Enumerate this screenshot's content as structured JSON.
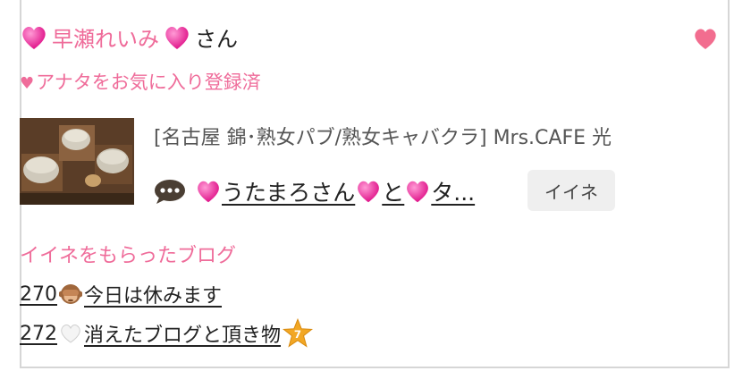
{
  "header": {
    "user_name": "早瀬れいみ",
    "suffix": "さん",
    "fav_icon": "heart-icon",
    "colors": {
      "accent": "#ef6c9a",
      "heart": "#f26d8f"
    }
  },
  "favorite_status": {
    "heart": "♥",
    "label": "アナタをお気に入り登録済"
  },
  "activity": {
    "shop_label": "[名古屋 錦･熟女パブ/熟女キャバクラ]  Mrs.CAFE 光",
    "blog_pre": "うたまろさん",
    "blog_mid": "と",
    "blog_post": "タ...",
    "iine_button": "イイネ"
  },
  "received": {
    "title": "イイネをもらったブログ",
    "posts": [
      {
        "number": "270",
        "text": "今日は休みます",
        "icon": "see-no-evil-monkey-icon"
      },
      {
        "number": "272",
        "text": "消えたブログと頂き物",
        "icon": "white-heart-icon",
        "trailing_icon": "star-badge-icon"
      }
    ]
  }
}
